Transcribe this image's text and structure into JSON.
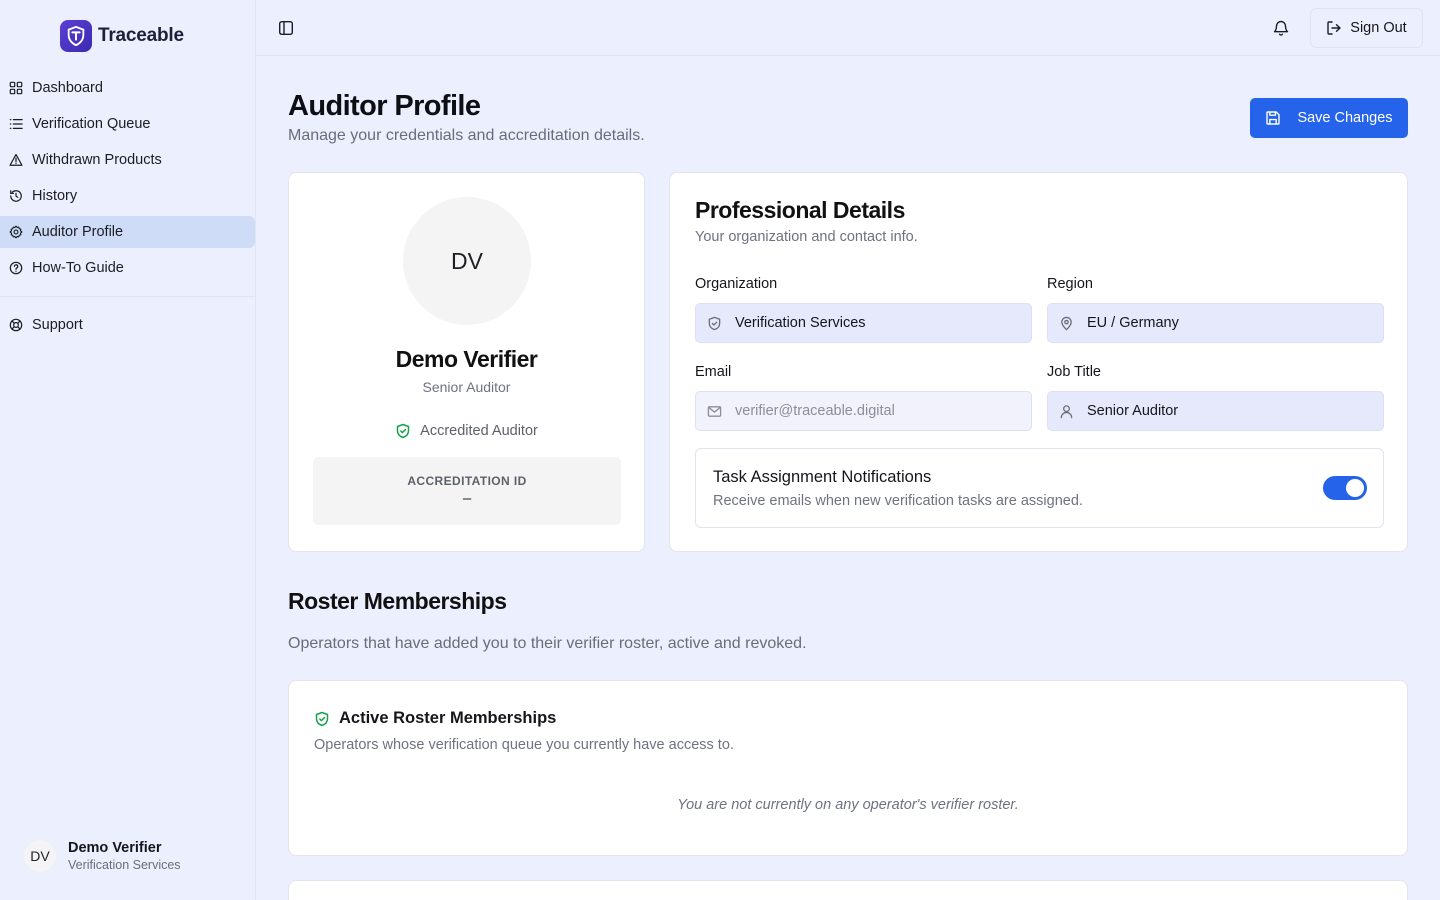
{
  "brand": {
    "name": "Traceable"
  },
  "sidebar": {
    "items": [
      {
        "label": "Dashboard",
        "icon": "grid-icon"
      },
      {
        "label": "Verification Queue",
        "icon": "list-icon"
      },
      {
        "label": "Withdrawn Products",
        "icon": "warning-icon"
      },
      {
        "label": "History",
        "icon": "history-icon"
      },
      {
        "label": "Auditor Profile",
        "icon": "gear-icon",
        "active": true
      },
      {
        "label": "How-To Guide",
        "icon": "help-circle-icon"
      }
    ],
    "support": {
      "label": "Support",
      "icon": "lifebuoy-icon"
    },
    "user": {
      "initials": "DV",
      "name": "Demo Verifier",
      "org": "Verification Services"
    }
  },
  "topbar": {
    "sign_out": "Sign Out"
  },
  "header": {
    "title": "Auditor Profile",
    "subtitle": "Manage your credentials and accreditation details.",
    "save_label": "Save Changes"
  },
  "profile": {
    "initials": "DV",
    "name": "Demo Verifier",
    "role": "Senior Auditor",
    "badge": "Accredited Auditor",
    "accreditation_label": "ACCREDITATION ID",
    "accreditation_value": "–"
  },
  "details": {
    "title": "Professional Details",
    "subtitle": "Your organization and contact info.",
    "organization_label": "Organization",
    "organization_value": "Verification Services",
    "region_label": "Region",
    "region_value": "EU / Germany",
    "email_label": "Email",
    "email_value": "verifier@traceable.digital",
    "job_label": "Job Title",
    "job_value": "Senior Auditor",
    "notif_title": "Task Assignment Notifications",
    "notif_sub": "Receive emails when new verification tasks are assigned.",
    "notif_enabled": true
  },
  "roster": {
    "title": "Roster Memberships",
    "subtitle": "Operators that have added you to their verifier roster, active and revoked.",
    "active_title": "Active Roster Memberships",
    "active_sub": "Operators whose verification queue you currently have access to.",
    "empty": "You are not currently on any operator's verifier roster."
  },
  "colors": {
    "accent": "#2563eb",
    "brand": "#4b32c3",
    "success": "#16a34a",
    "active_nav": "#cfdcf7",
    "background": "#eceffd"
  }
}
